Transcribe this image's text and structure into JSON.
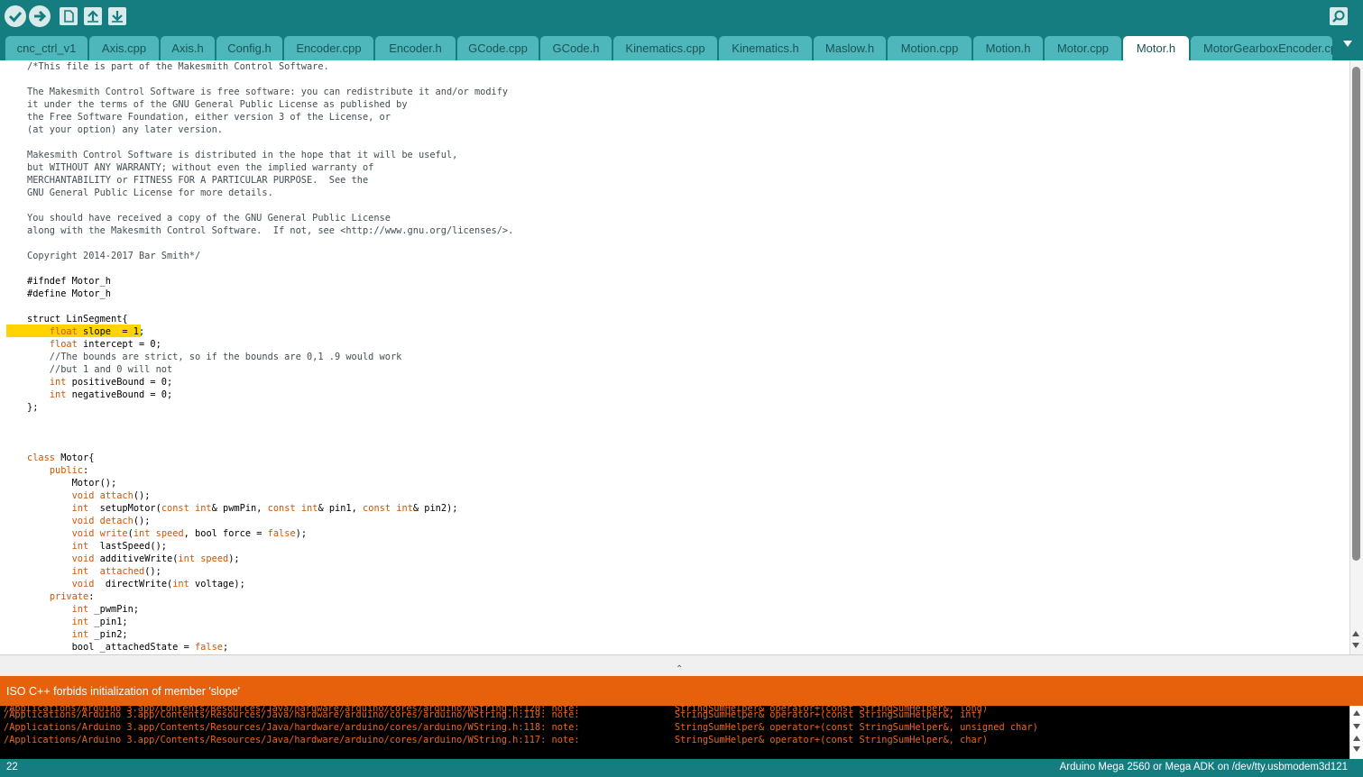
{
  "toolbar": {
    "buttons": [
      {
        "name": "verify",
        "icon": "checkmark-icon"
      },
      {
        "name": "upload",
        "icon": "arrow-right-icon"
      },
      {
        "name": "new",
        "icon": "new-file-icon"
      },
      {
        "name": "open",
        "icon": "arrow-up-icon"
      },
      {
        "name": "save",
        "icon": "arrow-down-icon"
      }
    ],
    "serial_monitor_icon": "magnifier-icon"
  },
  "tabs": [
    {
      "label": "cnc_ctrl_v1"
    },
    {
      "label": "Axis.cpp"
    },
    {
      "label": "Axis.h"
    },
    {
      "label": "Config.h"
    },
    {
      "label": "Encoder.cpp"
    },
    {
      "label": "Encoder.h"
    },
    {
      "label": "GCode.cpp"
    },
    {
      "label": "GCode.h"
    },
    {
      "label": "Kinematics.cpp"
    },
    {
      "label": "Kinematics.h"
    },
    {
      "label": "Maslow.h"
    },
    {
      "label": "Motion.cpp"
    },
    {
      "label": "Motion.h"
    },
    {
      "label": "Motor.cpp"
    },
    {
      "label": "Motor.h",
      "active": true
    },
    {
      "label": "MotorGearboxEncoder.cpp"
    }
  ],
  "code": {
    "highlighted_line": 22,
    "lines": [
      "/*This file is part of the Makesmith Control Software.",
      "",
      "The Makesmith Control Software is free software: you can redistribute it and/or modify",
      "it under the terms of the GNU General Public License as published by",
      "the Free Software Foundation, either version 3 of the License, or",
      "(at your option) any later version.",
      "",
      "Makesmith Control Software is distributed in the hope that it will be useful,",
      "but WITHOUT ANY WARRANTY; without even the implied warranty of",
      "MERCHANTABILITY or FITNESS FOR A PARTICULAR PURPOSE.  See the",
      "GNU General Public License for more details.",
      "",
      "You should have received a copy of the GNU General Public License",
      "along with the Makesmith Control Software.  If not, see <http://www.gnu.org/licenses/>.",
      "",
      "Copyright 2014-2017 Bar Smith*/",
      "",
      "#ifndef Motor_h",
      "#define Motor_h",
      "",
      "struct LinSegment{",
      "    float slope  = 1;",
      "    float intercept = 0;",
      "    //The bounds are strict, so if the bounds are 0,1 .9 would work",
      "    //but 1 and 0 will not",
      "    int positiveBound = 0;",
      "    int negativeBound = 0;",
      "};",
      "",
      "",
      "",
      "class Motor{",
      "    public:",
      "        Motor();",
      "        void attach();",
      "        int  setupMotor(const int& pwmPin, const int& pin1, const int& pin2);",
      "        void detach();",
      "        void write(int speed, bool force = false);",
      "        int  lastSpeed();",
      "        void additiveWrite(int speed);",
      "        int  attached();",
      "        void  directWrite(int voltage);",
      "    private:",
      "        int _pwmPin;",
      "        int _pin1;",
      "        int _pin2;",
      "        bool _attachedState = false;"
    ]
  },
  "status": {
    "message": "ISO C++ forbids initialization of member 'slope'",
    "color": "#e7610c"
  },
  "console": {
    "lines": [
      "/Applications/Arduino 3.app/Contents/Resources/Java/hardware/arduino/cores/arduino/WString.h:119: note:                 StringSumHelper& operator+(const StringSumHelper&, int)",
      "/Applications/Arduino 3.app/Contents/Resources/Java/hardware/arduino/cores/arduino/WString.h:118: note:                 StringSumHelper& operator+(const StringSumHelper&, unsigned char)",
      "/Applications/Arduino 3.app/Contents/Resources/Java/hardware/arduino/cores/arduino/WString.h:117: note:                 StringSumHelper& operator+(const StringSumHelper&, char)"
    ]
  },
  "footer": {
    "line_number": "22",
    "board": "Arduino Mega 2560 or Mega ADK on /dev/tty.usbmodem3d121"
  },
  "colors": {
    "teal": "#157c7f",
    "tab": "#4db7bb",
    "highlight": "#ffd400",
    "keyword": "#d35400",
    "error_bar": "#e7610c"
  }
}
